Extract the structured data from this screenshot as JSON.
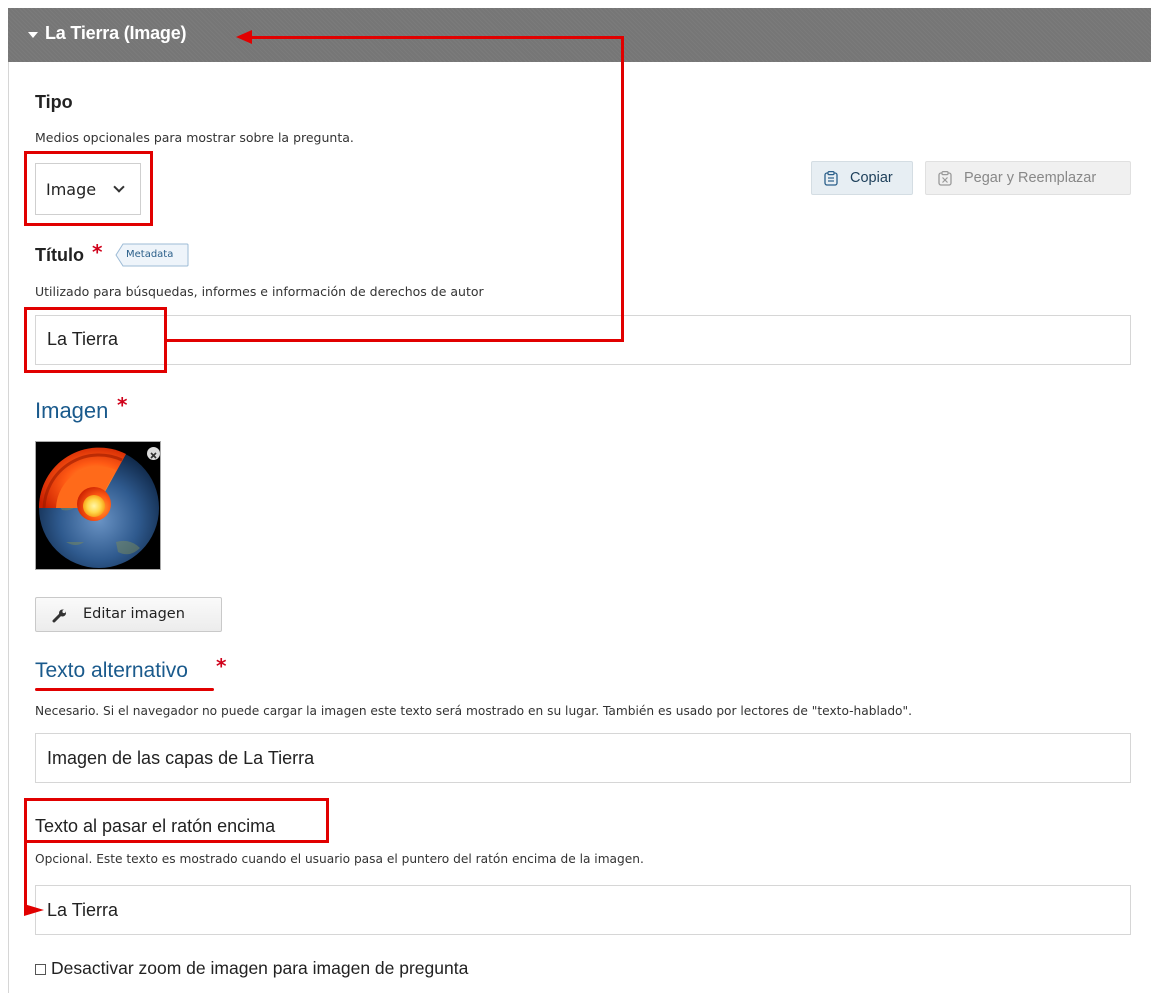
{
  "header": {
    "title": "La Tierra (Image)"
  },
  "tipo": {
    "label": "Tipo",
    "description": "Medios opcionales para mostrar sobre la pregunta.",
    "selected": "Image"
  },
  "toolbar": {
    "copy_label": "Copiar",
    "paste_label": "Pegar y Reemplazar"
  },
  "titulo": {
    "label": "Título",
    "required_mark": "*",
    "metadata_tag": "Metadata",
    "description": "Utilizado para búsquedas, informes e información de derechos de autor",
    "value": "La Tierra"
  },
  "imagen": {
    "label": "Imagen",
    "required_mark": "*",
    "edit_button": "Editar imagen"
  },
  "alt_text": {
    "label": "Texto alternativo",
    "required_mark": "*",
    "description": "Necesario. Si el navegador no puede cargar la imagen este texto será mostrado en su lugar. También es usado por lectores de \"texto-hablado\".",
    "value": "Imagen de las capas de La Tierra"
  },
  "hover_text": {
    "label": "Texto al pasar el ratón encima",
    "description": "Opcional. Este texto es mostrado cuando el usuario pasa el puntero del ratón encima de la imagen.",
    "value": "La Tierra"
  },
  "zoom_option": {
    "label": "Desactivar zoom de imagen para imagen de pregunta",
    "checked": false
  },
  "colors": {
    "header_bg": "#767676",
    "link_blue": "#1a5a8c",
    "required_red": "#d0021b",
    "annotation_red": "#e10000"
  }
}
